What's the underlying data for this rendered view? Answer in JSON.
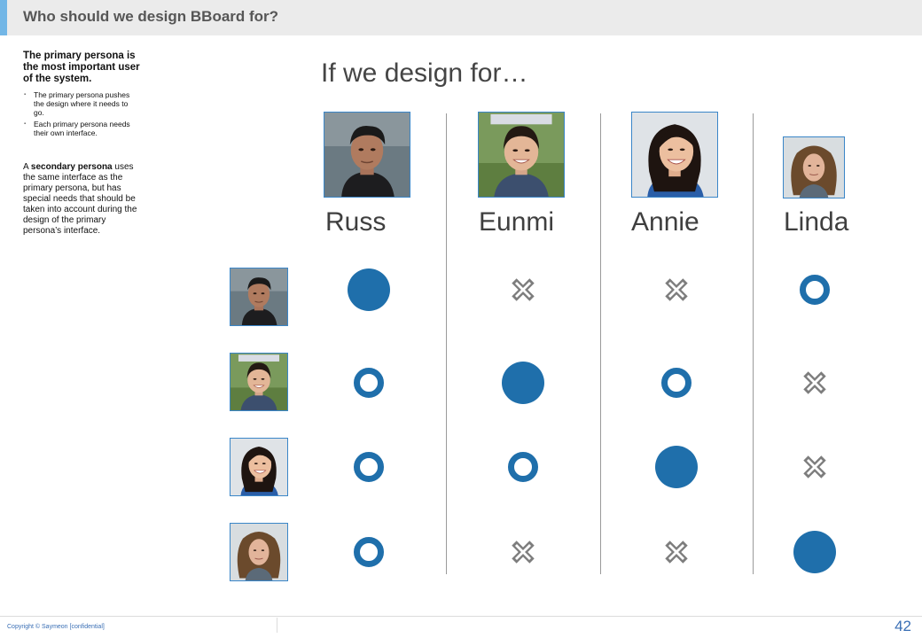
{
  "header": {
    "title": "Who should we design BBoard for?"
  },
  "sidebar": {
    "primary_heading": "The primary persona is the most important user of the system.",
    "bullets": [
      "The primary persona pushes the design where it needs to go.",
      "Each primary persona needs their own interface."
    ],
    "secondary_prefix": "A ",
    "secondary_term": "secondary persona",
    "secondary_rest": " uses the same interface as the primary persona, but has special needs that should be taken into account during the design of the primary persona’s interface."
  },
  "main": {
    "heading": "If we design for…",
    "columns": [
      {
        "name": "Russ"
      },
      {
        "name": "Eunmi"
      },
      {
        "name": "Annie"
      },
      {
        "name": "Linda"
      }
    ]
  },
  "matrix": {
    "legend_kinds": [
      "primary",
      "secondary",
      "not-served"
    ],
    "rows": [
      [
        "primary",
        "not-served",
        "not-served",
        "secondary"
      ],
      [
        "secondary",
        "primary",
        "secondary",
        "not-served"
      ],
      [
        "secondary",
        "secondary",
        "primary",
        "not-served"
      ],
      [
        "secondary",
        "not-served",
        "not-served",
        "primary"
      ]
    ],
    "colors": {
      "mark": "#1f6fab",
      "cross": "#7d7d7d",
      "photo_border": "#3a86c8"
    }
  },
  "footer": {
    "copyright": "Copyright © Saymeon [confidential]",
    "page_number": "42"
  }
}
